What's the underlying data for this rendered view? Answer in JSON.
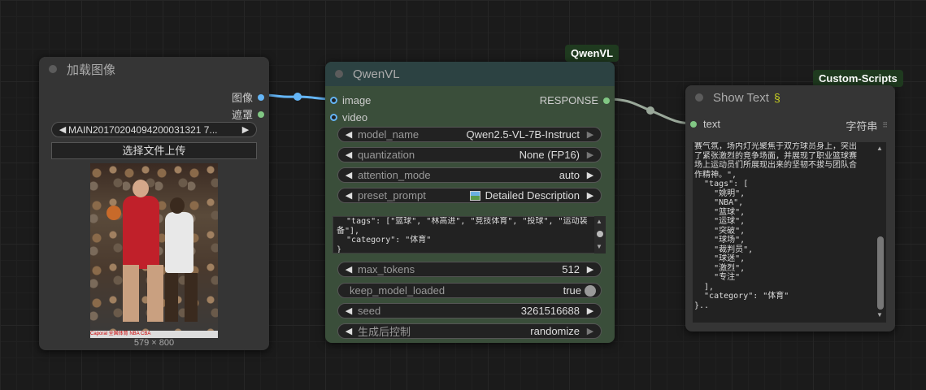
{
  "colors": {
    "image_link": "#64b5f6",
    "response_link": "#9aa89a",
    "mask_slot": "#81c784",
    "qwen_title": "#2c4242",
    "qwen_body": "#3a4e3a",
    "node_body": "#353535"
  },
  "load_image": {
    "title": "加载图像",
    "out_image": "图像",
    "out_mask": "遮罩",
    "file_name": "MAIN20170204094200031321 7...",
    "upload_button": "选择文件上传",
    "image_caption": "579 × 800",
    "image_watermark": "Caporal 全国体育 NBA CBA"
  },
  "qwen": {
    "badge": "QwenVL",
    "title": "QwenVL",
    "in_image": "image",
    "in_video": "video",
    "out_response": "RESPONSE",
    "widgets": [
      {
        "label": "model_name",
        "value": "Qwen2.5-VL-7B-Instruct"
      },
      {
        "label": "quantization",
        "value": "None (FP16)"
      },
      {
        "label": "attention_mode",
        "value": "auto"
      },
      {
        "label": "preset_prompt",
        "value": "Detailed Description"
      }
    ],
    "prompt_text": "  \"tags\": [\"篮球\", \"林高进\", \"竞技体育\", \"投球\", \"运动装\n备\"],\n  \"category\": \"体育\"\n}",
    "widgets2": [
      {
        "label": "max_tokens",
        "value": "512"
      },
      {
        "label": "keep_model_loaded",
        "value": "true"
      },
      {
        "label": "seed",
        "value": "3261516688"
      },
      {
        "label": "生成后控制",
        "value": "randomize"
      }
    ]
  },
  "show_text": {
    "badge": "Custom-Scripts",
    "title": "Show Text",
    "title_icon": "snake-icon",
    "in_text": "text",
    "out_string": "字符串",
    "content": "赛气氛，场内灯光聚焦于双方球员身上，突出\n了紧张激烈的竞争场面，并展现了职业篮球赛\n场上运动员们所展现出来的坚韧不拔与团队合\n作精神。\",\n  \"tags\": [\n    \"姚明\",\n    \"NBA\",\n    \"篮球\",\n    \"运球\",\n    \"突破\",\n    \"球场\",\n    \"裁判员\",\n    \"球迷\",\n    \"激烈\",\n    \"专注\"\n  ],\n  \"category\": \"体育\"\n}.."
  }
}
